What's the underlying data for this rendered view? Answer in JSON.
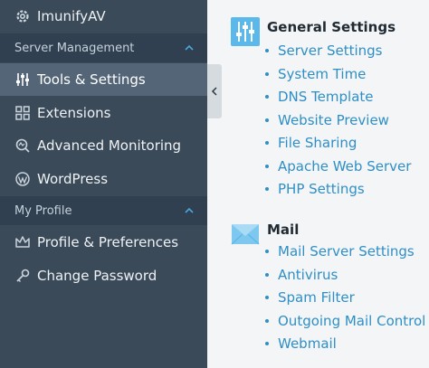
{
  "sidebar": {
    "top_item": {
      "label": "ImunifyAV",
      "icon": "gear-icon"
    },
    "sections": [
      {
        "title": "Server Management",
        "items": [
          {
            "label": "Tools & Settings",
            "icon": "sliders-icon",
            "active": true
          },
          {
            "label": "Extensions",
            "icon": "extensions-icon",
            "active": false
          },
          {
            "label": "Advanced Monitoring",
            "icon": "monitoring-icon",
            "active": false
          },
          {
            "label": "WordPress",
            "icon": "wordpress-icon",
            "active": false
          }
        ]
      },
      {
        "title": "My Profile",
        "items": [
          {
            "label": "Profile & Preferences",
            "icon": "crown-icon",
            "active": false
          },
          {
            "label": "Change Password",
            "icon": "key-icon",
            "active": false
          }
        ]
      }
    ]
  },
  "content": {
    "groups": [
      {
        "title": "General Settings",
        "icon": "general-settings-icon",
        "links": [
          "Server Settings",
          "System Time",
          "DNS Template",
          "Website Preview",
          "File Sharing",
          "Apache Web Server",
          "PHP Settings"
        ]
      },
      {
        "title": "Mail",
        "icon": "mail-envelope-icon",
        "links": [
          "Mail Server Settings",
          "Antivirus",
          "Spam Filter",
          "Outgoing Mail Control",
          "Webmail"
        ]
      }
    ]
  },
  "colors": {
    "sidebar_bg": "#3b4a59",
    "section_bg": "#304050",
    "active_bg": "#536577",
    "link": "#2e8fc7",
    "icon_blue": "#5bb8ea"
  }
}
